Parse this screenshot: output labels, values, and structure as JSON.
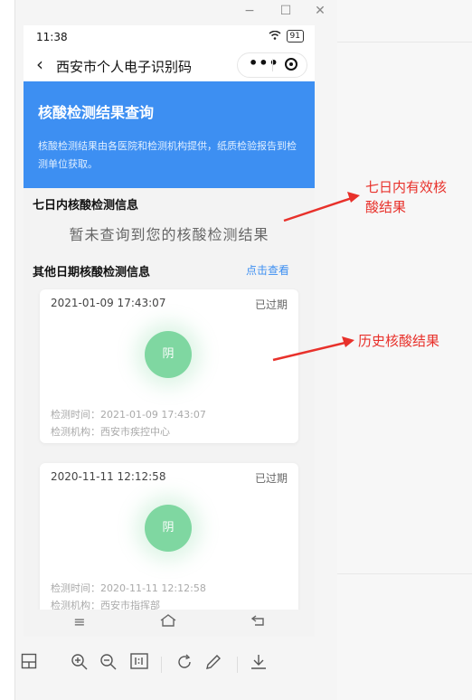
{
  "window": {
    "minimize": "−",
    "maximize": "☐",
    "close": "✕"
  },
  "statusbar": {
    "time": "11:38",
    "battery": "91"
  },
  "navbar": {
    "title": "西安市个人电子识别码",
    "more": "•••"
  },
  "banner": {
    "title": "核酸检测结果查询",
    "description": "核酸检测结果由各医院和检测机构提供，纸质检验报告到检测单位获取。"
  },
  "section_recent": {
    "title": "七日内核酸检测信息",
    "empty_message": "暂未查询到您的核酸检测结果"
  },
  "section_other": {
    "title": "其他日期核酸检测信息",
    "link": "点击查看"
  },
  "records": [
    {
      "datetime": "2021-01-09 17:43:07",
      "status": "已过期",
      "result": "阴",
      "test_time": "检测时间：2021-01-09 17:43:07",
      "institution": "检测机构：西安市疾控中心"
    },
    {
      "datetime": "2020-11-11 12:12:58",
      "status": "已过期",
      "result": "阴",
      "test_time": "检测时间：2020-11-11 12:12:58",
      "institution": "检测机构：西安市指挥部"
    }
  ],
  "annotations": {
    "recent_line1": "七日内有效核",
    "recent_line2": "酸结果",
    "history": "历史核酸结果",
    "color": "#e8312b"
  },
  "colors": {
    "banner": "#3d8ff2",
    "negative_badge": "#7fd7a1",
    "link": "#3d8ff2"
  }
}
